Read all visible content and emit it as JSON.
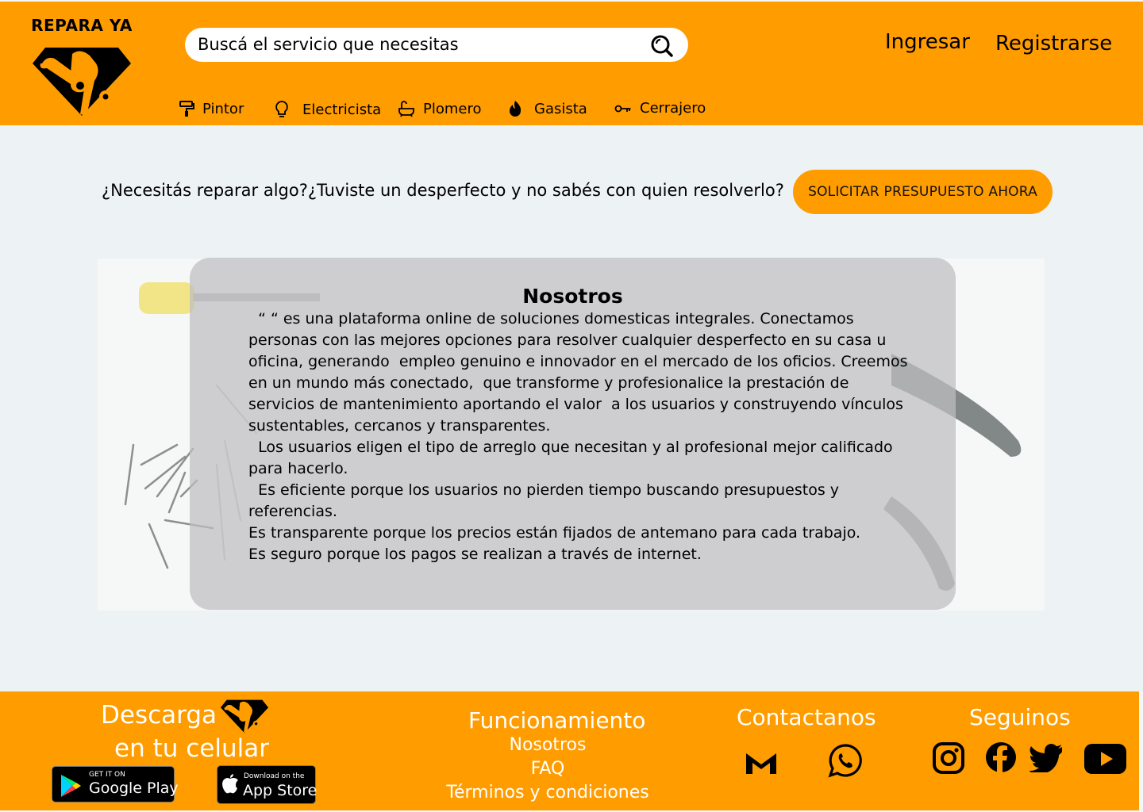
{
  "brand": {
    "name": "REPARA YA"
  },
  "search": {
    "placeholder": "Buscá el servicio que necesitas"
  },
  "auth": {
    "login": "Ingresar",
    "register": "Registrarse"
  },
  "categories": [
    {
      "label": "Pintor",
      "icon": "paint-roller-icon"
    },
    {
      "label": "Electricista",
      "icon": "lightbulb-icon"
    },
    {
      "label": "Plomero",
      "icon": "bathtub-icon"
    },
    {
      "label": "Gasista",
      "icon": "flame-icon"
    },
    {
      "label": "Cerrajero",
      "icon": "key-icon"
    }
  ],
  "cta": {
    "text": "¿Necesitás reparar algo?¿Tuviste un desperfecto y no sabés con quien resolverlo?",
    "button": "SOLICITAR PRESUPUESTO AHORA"
  },
  "about": {
    "title": "Nosotros",
    "body": "  “ “ es una plataforma online de soluciones domesticas integrales. Conectamos personas con las mejores opciones para resolver cualquier desperfecto en su casa u oficina, generando  empleo genuino e innovador en el mercado de los oficios. Creemos en un mundo más conectado,  que transforme y profesionalice la prestación de servicios de mantenimiento aportando el valor  a los usuarios y construyendo vínculos sustentables, cercanos y transparentes.\n  Los usuarios eligen el tipo de arreglo que necesitan y al profesional mejor calificado para hacerlo.\n  Es eficiente porque los usuarios no pierden tiempo buscando presupuestos y referencias.\nEs transparente porque los precios están fijados de antemano para cada trabajo.\nEs seguro porque los pagos se realizan a través de internet."
  },
  "footer": {
    "download_line1": "Descarga",
    "download_line2": "en tu celular",
    "google_play": {
      "small": "GET IT ON",
      "big": "Google Play"
    },
    "app_store": {
      "small": "Download on the",
      "big": "App Store"
    },
    "funcionamiento": {
      "title": "Funcionamiento",
      "links": [
        "Nosotros",
        "FAQ",
        "Términos y condiciones"
      ]
    },
    "contact_title": "Contactanos",
    "follow_title": "Seguinos",
    "contact_icons": [
      "gmail-icon",
      "whatsapp-icon"
    ],
    "social_icons": [
      "instagram-icon",
      "facebook-icon",
      "twitter-icon",
      "youtube-icon"
    ]
  },
  "colors": {
    "accent": "#ff9c00",
    "background": "#edf2f5",
    "overlay": "#bebec0"
  }
}
